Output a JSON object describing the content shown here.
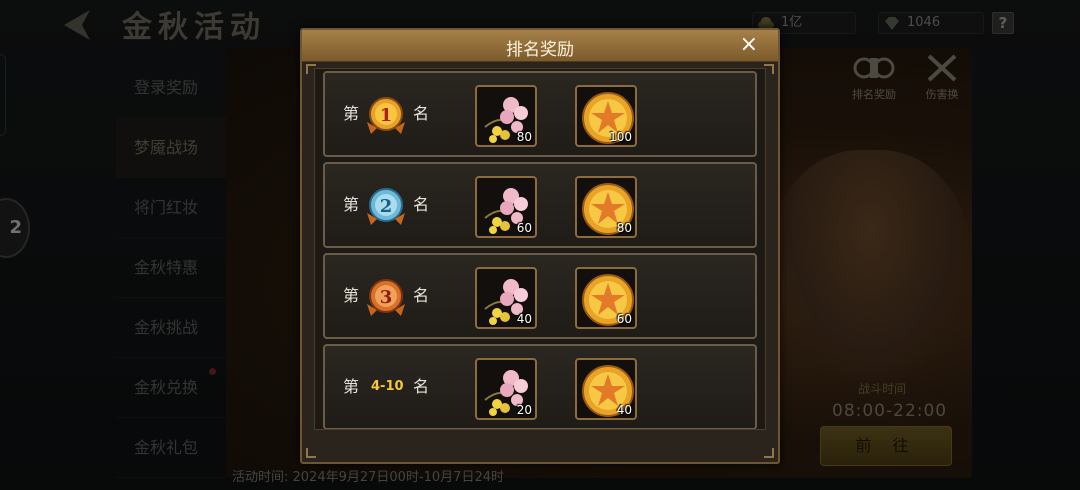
{
  "page": {
    "title": "金秋活动",
    "gold_amount": "1亿",
    "gem_amount": "1046",
    "help_label": "?",
    "float_label": "2"
  },
  "side_menu": [
    {
      "label": "登录奖励",
      "active": false
    },
    {
      "label": "梦魇战场",
      "active": true
    },
    {
      "label": "将门红妆",
      "active": false
    },
    {
      "label": "金秋特惠",
      "active": false
    },
    {
      "label": "金秋挑战",
      "active": false
    },
    {
      "label": "金秋兑换",
      "active": false,
      "badge": true
    },
    {
      "label": "金秋礼包",
      "active": false
    }
  ],
  "content": {
    "rank_reward_tab": "排名奖励",
    "damage_exchange_tab": "伤害换",
    "battle_time_label": "战斗时间",
    "battle_time": "08:00-22:00",
    "goto_button": "前 往",
    "activity_time": "活动时间: 2024年9月27日00时-10月7日24时"
  },
  "modal": {
    "title": "排名奖励",
    "close_label": "×",
    "rows": [
      {
        "prefix": "第",
        "medal": "1",
        "suffix": "名",
        "flower_count": "80",
        "coin_count": "100"
      },
      {
        "prefix": "第",
        "medal": "2",
        "suffix": "名",
        "flower_count": "60",
        "coin_count": "80"
      },
      {
        "prefix": "第",
        "medal": "3",
        "suffix": "名",
        "flower_count": "40",
        "coin_count": "60"
      },
      {
        "prefix": "第",
        "range": "4-10",
        "suffix": "名",
        "flower_count": "20",
        "coin_count": "40"
      }
    ]
  },
  "colors": {
    "gold_medal": "#e8a22a",
    "silver_medal": "#6fb9d8",
    "bronze_medal": "#d9702a",
    "accent": "#f6c640"
  }
}
